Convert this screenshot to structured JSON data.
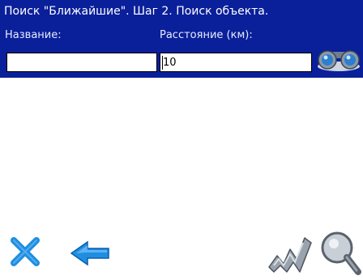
{
  "window": {
    "title": "Поиск \"Ближайшие\". Шаг 2. Поиск объекта."
  },
  "form": {
    "name_label": "Название:",
    "name_value": "",
    "distance_label": "Расстояние (км):",
    "distance_value": "10"
  },
  "toolbar": {
    "search_icon": "binoculars-icon",
    "close_icon": "close-x-icon",
    "back_icon": "back-arrow-icon",
    "route_icon": "route-icon",
    "map_search_icon": "magnifier-pin-icon"
  },
  "colors": {
    "header_bg": "#0a1f9a",
    "accent_blue": "#1e8fe0"
  }
}
